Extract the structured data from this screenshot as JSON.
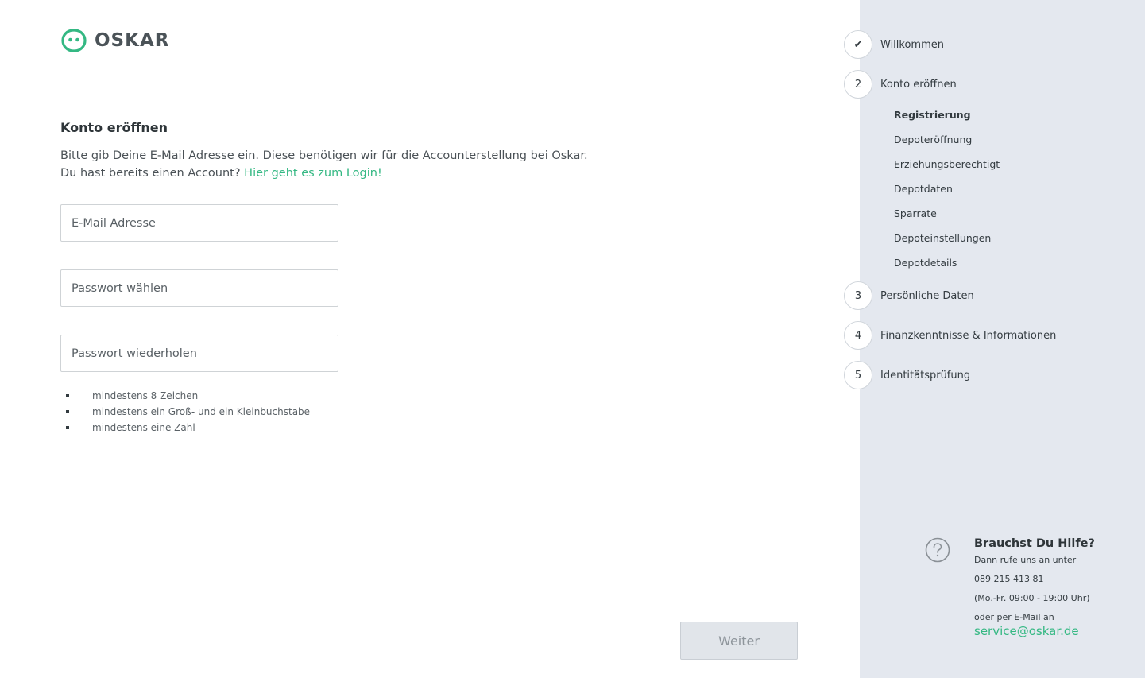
{
  "brand": {
    "name": "OSKAR",
    "accent_color": "#34b883",
    "logo_icon": "oskar-face-icon"
  },
  "main": {
    "title": "Konto eröffnen",
    "intro_line1": "Bitte gib Deine E-Mail Adresse ein. Diese benötigen wir für die Accounterstellung bei Oskar.",
    "intro_line2_prefix": "Du hast bereits einen Account?",
    "login_link": "Hier geht es zum Login!",
    "email_placeholder": "E-Mail Adresse",
    "password_placeholder": "Passwort wählen",
    "password_repeat_placeholder": "Passwort wiederholen",
    "password_rules": [
      "mindestens 8 Zeichen",
      "mindestens ein Groß- und ein Kleinbuchstabe",
      "mindestens eine Zahl"
    ],
    "next_button": "Weiter"
  },
  "sidebar": {
    "steps": [
      {
        "marker": "✔",
        "label": "Willkommen",
        "icon": "check-icon"
      },
      {
        "marker": "2",
        "label": "Konto eröffnen"
      },
      {
        "marker": "3",
        "label": "Persönliche Daten"
      },
      {
        "marker": "4",
        "label": "Finanzkenntnisse & Informationen"
      },
      {
        "marker": "5",
        "label": "Identitätsprüfung"
      }
    ],
    "substeps": [
      "Registrierung",
      "Depoteröffnung",
      "Erziehungsberechtigt",
      "Depotdaten",
      "Sparrate",
      "Depoteinstellungen",
      "Depotdetails"
    ],
    "active_substep": "Registrierung"
  },
  "help": {
    "icon": "question-circle-icon",
    "title": "Brauchst Du Hilfe?",
    "line1": "Dann rufe uns an unter",
    "phone": "089 215 413 81",
    "hours": "(Mo.-Fr. 09:00 - 19:00 Uhr)",
    "line4": "oder per E-Mail an",
    "email": "service@oskar.de"
  }
}
